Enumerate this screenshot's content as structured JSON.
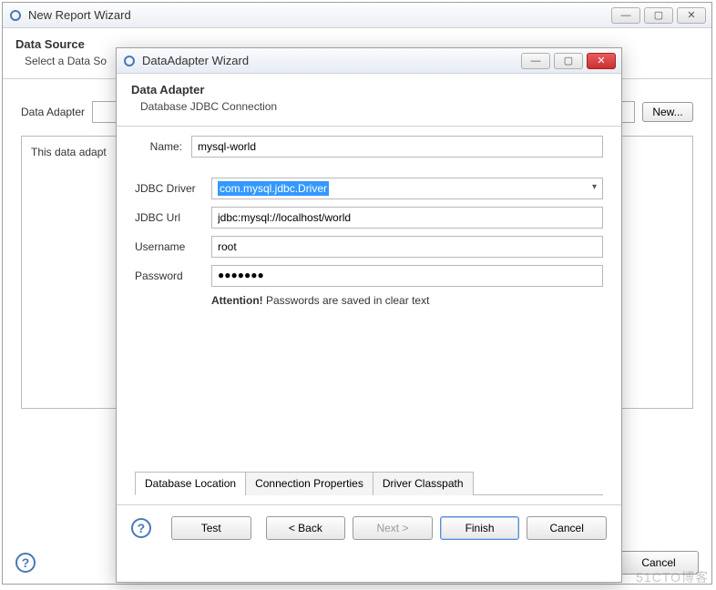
{
  "outer": {
    "title": "New Report Wizard",
    "heading": "Data Source",
    "subheading": "Select a Data So",
    "adapter_label": "Data Adapter",
    "new_btn": "New...",
    "fieldset_text": "This data adapt",
    "cancel_btn": "Cancel"
  },
  "inner": {
    "title": "DataAdapter Wizard",
    "heading": "Data Adapter",
    "subheading": "Database JDBC Connection",
    "name_label": "Name:",
    "name_value": "mysql-world",
    "driver_label": "JDBC Driver",
    "driver_value": "com.mysql.jdbc.Driver",
    "url_label": "JDBC Url",
    "url_value": "jdbc:mysql://localhost/world",
    "user_label": "Username",
    "user_value": "root",
    "pass_label": "Password",
    "pass_value": "●●●●●●●",
    "attention_bold": "Attention!",
    "attention_text": " Passwords are saved in clear text",
    "tabs": {
      "loc": "Database Location",
      "conn": "Connection Properties",
      "driver": "Driver Classpath"
    },
    "buttons": {
      "test": "Test",
      "back": "< Back",
      "next": "Next >",
      "finish": "Finish",
      "cancel": "Cancel"
    }
  },
  "watermark": "51CTO博客"
}
